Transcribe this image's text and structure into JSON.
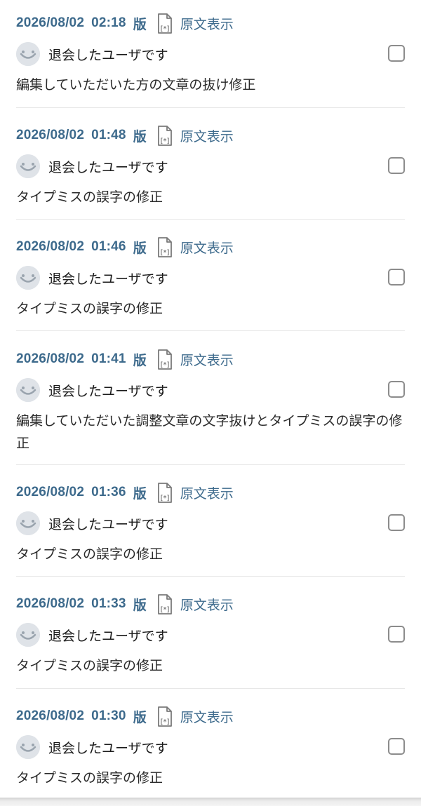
{
  "source_label": "原文表示",
  "revisions": [
    {
      "date": "2026/08/02",
      "time": "02:18",
      "version": "版",
      "user": "退会したユーザです",
      "comment": "編集していただいた方の文章の抜け修正"
    },
    {
      "date": "2026/08/02",
      "time": "01:48",
      "version": "版",
      "user": "退会したユーザです",
      "comment": "タイプミスの誤字の修正"
    },
    {
      "date": "2026/08/02",
      "time": "01:46",
      "version": "版",
      "user": "退会したユーザです",
      "comment": "タイプミスの誤字の修正"
    },
    {
      "date": "2026/08/02",
      "time": "01:41",
      "version": "版",
      "user": "退会したユーザです",
      "comment": "編集していただいた調整文章の文字抜けとタイプミスの誤字の修正"
    },
    {
      "date": "2026/08/02",
      "time": "01:36",
      "version": "版",
      "user": "退会したユーザです",
      "comment": "タイプミスの誤字の修正"
    },
    {
      "date": "2026/08/02",
      "time": "01:33",
      "version": "版",
      "user": "退会したユーザです",
      "comment": "タイプミスの誤字の修正"
    },
    {
      "date": "2026/08/02",
      "time": "01:30",
      "version": "版",
      "user": "退会したユーザです",
      "comment": "タイプミスの誤字の修正"
    }
  ],
  "colors": {
    "link": "#3d6a8c",
    "text": "#1b1b1b",
    "divider": "#e7e7e7",
    "checkbox_border": "#8c8c8c"
  }
}
